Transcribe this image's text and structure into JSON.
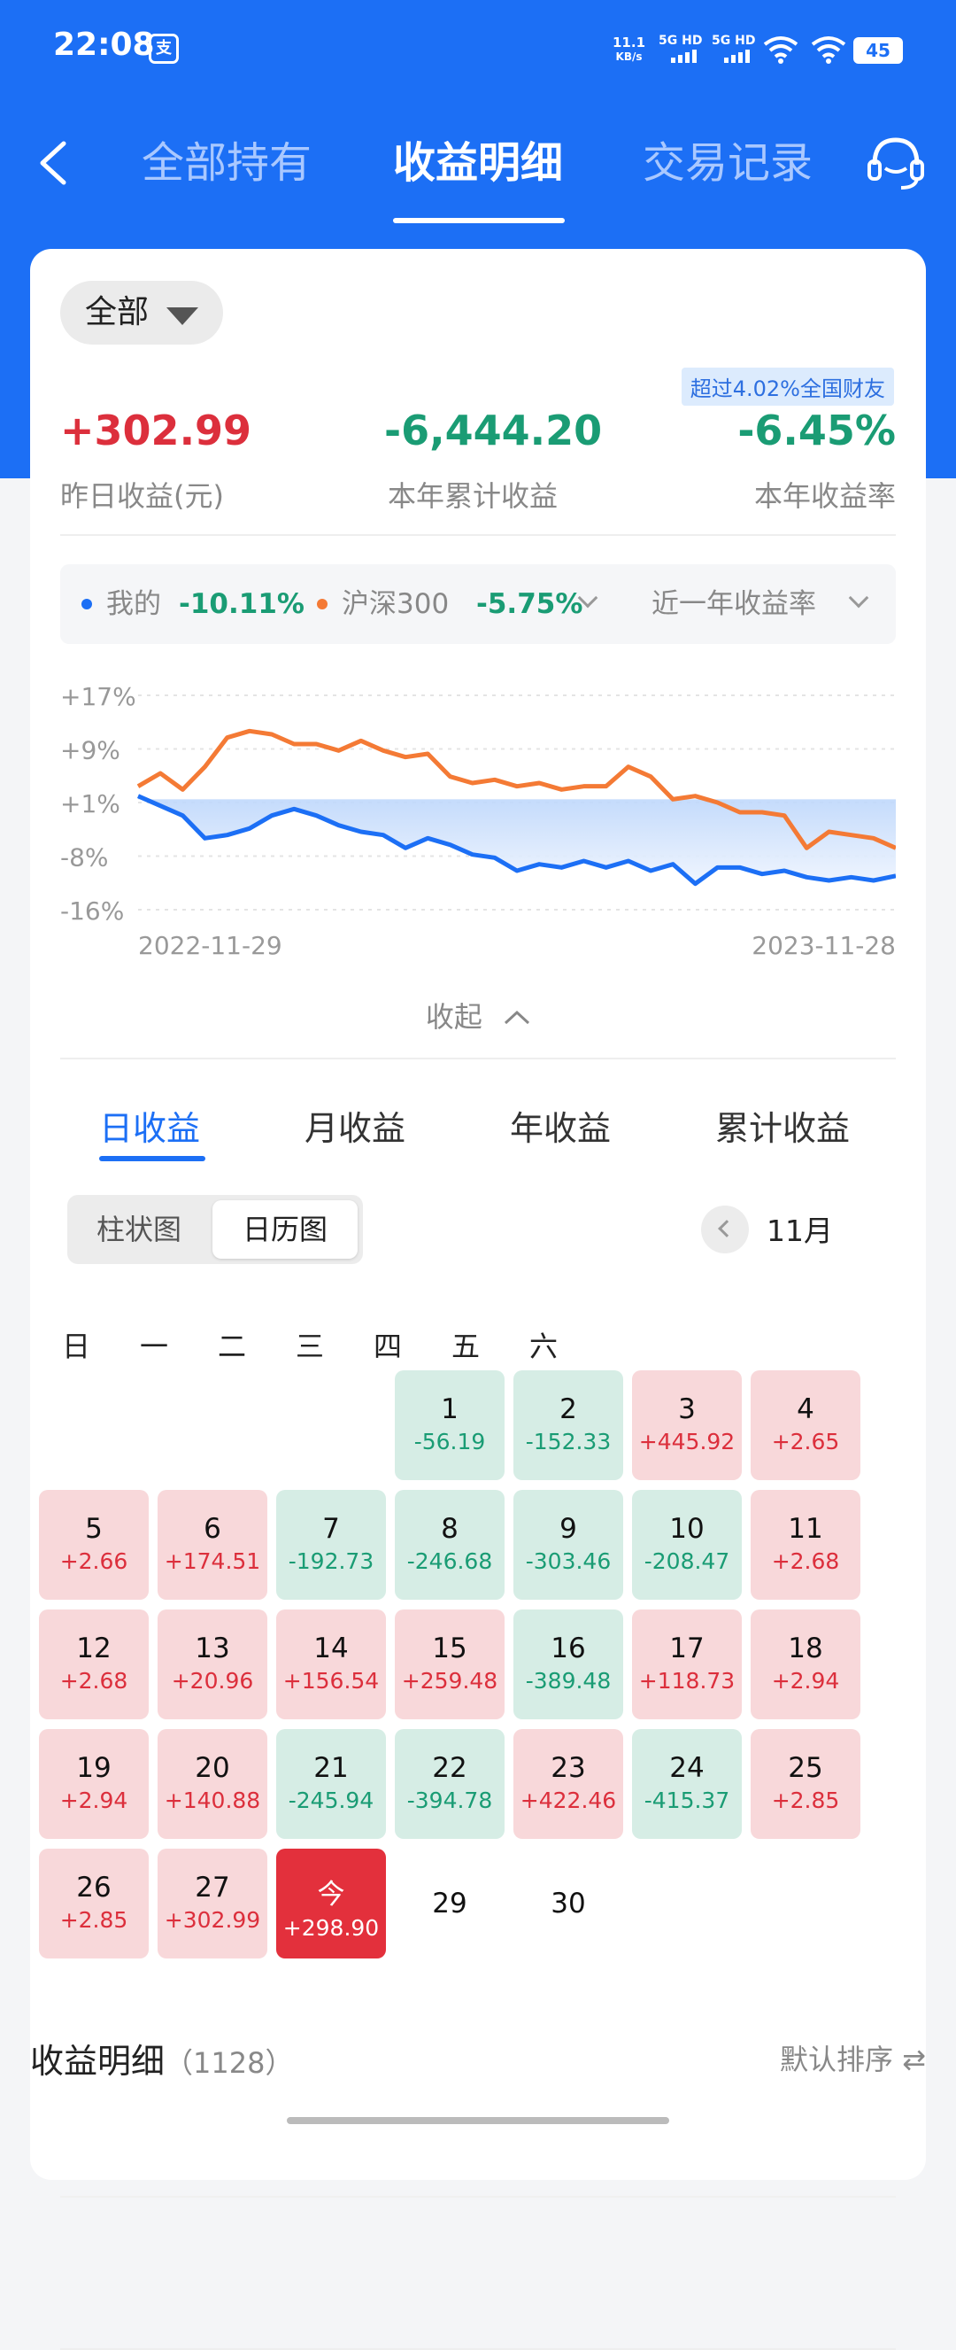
{
  "status_bar": {
    "time": "22:08",
    "app_icon": "支",
    "net_speed_value": "11.1",
    "net_speed_unit": "KB/s",
    "sim1": "5G HD",
    "sim2": "5G HD",
    "battery": "45"
  },
  "nav": {
    "tabs": [
      "全部持有",
      "收益明细",
      "交易记录"
    ],
    "active_tab": 1,
    "back_icon": "chevron-left-icon",
    "service_icon": "headset-icon"
  },
  "filter": {
    "label": "全部"
  },
  "badge": "超过4.02%全国财友",
  "stats": [
    {
      "value": "+302.99",
      "label": "昨日收益(元)",
      "color": "#dc2f3c"
    },
    {
      "value": "-6,444.20",
      "label": "本年累计收益",
      "color": "#1a9c74"
    },
    {
      "value": "-6.45%",
      "label": "本年收益率",
      "color": "#1a9c74"
    }
  ],
  "legend": {
    "mine_label": "我的",
    "mine_value": "-10.11%",
    "index_label": "沪深300",
    "index_value": "-5.75%",
    "period_label": "近一年收益率"
  },
  "chart_data": {
    "type": "line",
    "y_ticks": [
      "+17%",
      "+9%",
      "+1%",
      "-8%",
      "-16%"
    ],
    "ylim": [
      -16,
      17
    ],
    "x_start": "2022-11-29",
    "x_end": "2023-11-28",
    "series": [
      {
        "name": "我的",
        "color": "#1c6ff5",
        "values": [
          1.5,
          0,
          -1.5,
          -5,
          -4.5,
          -3.5,
          -1.5,
          -0.5,
          -1.5,
          -3,
          -4,
          -4.5,
          -6.5,
          -5,
          -6,
          -7.5,
          -8,
          -10,
          -9,
          -9.5,
          -8.5,
          -9.5,
          -8.5,
          -10,
          -9,
          -12,
          -9.5,
          -9.5,
          -10.5,
          -10,
          -11,
          -11.5,
          -11,
          -11.5,
          -10.8
        ]
      },
      {
        "name": "沪深300",
        "color": "#f47a35",
        "values": [
          3,
          5,
          2.5,
          6,
          10.5,
          11.5,
          11,
          9.5,
          9.5,
          8.5,
          10,
          8.5,
          7.5,
          8,
          4.5,
          3.5,
          4,
          3,
          3.5,
          2.5,
          3,
          3,
          6,
          4.5,
          1,
          1.5,
          0.5,
          -1,
          -1,
          -1.5,
          -6.5,
          -4,
          -4.5,
          -5,
          -6.5
        ]
      }
    ]
  },
  "collapse_label": "收起",
  "range_tabs": [
    "日收益",
    "月收益",
    "年收益",
    "累计收益"
  ],
  "view_toggle": [
    "柱状图",
    "日历图"
  ],
  "month": "11月",
  "weekdays": [
    "日",
    "一",
    "二",
    "三",
    "四",
    "五",
    "六"
  ],
  "calendar": [
    {
      "day": "1",
      "value": "-56.19",
      "sign": "neg",
      "col": 3,
      "row": 0
    },
    {
      "day": "2",
      "value": "-152.33",
      "sign": "neg",
      "col": 4,
      "row": 0
    },
    {
      "day": "3",
      "value": "+445.92",
      "sign": "pos",
      "col": 5,
      "row": 0
    },
    {
      "day": "4",
      "value": "+2.65",
      "sign": "pos",
      "col": 6,
      "row": 0
    },
    {
      "day": "5",
      "value": "+2.66",
      "sign": "pos",
      "col": 0,
      "row": 1
    },
    {
      "day": "6",
      "value": "+174.51",
      "sign": "pos",
      "col": 1,
      "row": 1
    },
    {
      "day": "7",
      "value": "-192.73",
      "sign": "neg",
      "col": 2,
      "row": 1
    },
    {
      "day": "8",
      "value": "-246.68",
      "sign": "neg",
      "col": 3,
      "row": 1
    },
    {
      "day": "9",
      "value": "-303.46",
      "sign": "neg",
      "col": 4,
      "row": 1
    },
    {
      "day": "10",
      "value": "-208.47",
      "sign": "neg",
      "col": 5,
      "row": 1
    },
    {
      "day": "11",
      "value": "+2.68",
      "sign": "pos",
      "col": 6,
      "row": 1
    },
    {
      "day": "12",
      "value": "+2.68",
      "sign": "pos",
      "col": 0,
      "row": 2
    },
    {
      "day": "13",
      "value": "+20.96",
      "sign": "pos",
      "col": 1,
      "row": 2
    },
    {
      "day": "14",
      "value": "+156.54",
      "sign": "pos",
      "col": 2,
      "row": 2
    },
    {
      "day": "15",
      "value": "+259.48",
      "sign": "pos",
      "col": 3,
      "row": 2
    },
    {
      "day": "16",
      "value": "-389.48",
      "sign": "neg",
      "col": 4,
      "row": 2
    },
    {
      "day": "17",
      "value": "+118.73",
      "sign": "pos",
      "col": 5,
      "row": 2
    },
    {
      "day": "18",
      "value": "+2.94",
      "sign": "pos",
      "col": 6,
      "row": 2
    },
    {
      "day": "19",
      "value": "+2.94",
      "sign": "pos",
      "col": 0,
      "row": 3
    },
    {
      "day": "20",
      "value": "+140.88",
      "sign": "pos",
      "col": 1,
      "row": 3
    },
    {
      "day": "21",
      "value": "-245.94",
      "sign": "neg",
      "col": 2,
      "row": 3
    },
    {
      "day": "22",
      "value": "-394.78",
      "sign": "neg",
      "col": 3,
      "row": 3
    },
    {
      "day": "23",
      "value": "+422.46",
      "sign": "pos",
      "col": 4,
      "row": 3
    },
    {
      "day": "24",
      "value": "-415.37",
      "sign": "neg",
      "col": 5,
      "row": 3
    },
    {
      "day": "25",
      "value": "+2.85",
      "sign": "pos",
      "col": 6,
      "row": 3
    },
    {
      "day": "26",
      "value": "+2.85",
      "sign": "pos",
      "col": 0,
      "row": 4
    },
    {
      "day": "27",
      "value": "+302.99",
      "sign": "pos",
      "col": 1,
      "row": 4
    },
    {
      "day": "今",
      "value": "+298.90",
      "sign": "today",
      "col": 2,
      "row": 4
    },
    {
      "day": "29",
      "value": "",
      "sign": "none",
      "col": 3,
      "row": 4
    },
    {
      "day": "30",
      "value": "",
      "sign": "none",
      "col": 4,
      "row": 4
    }
  ],
  "details": {
    "title": "收益明细",
    "count": "（1128）",
    "sort_label": "默认排序"
  }
}
